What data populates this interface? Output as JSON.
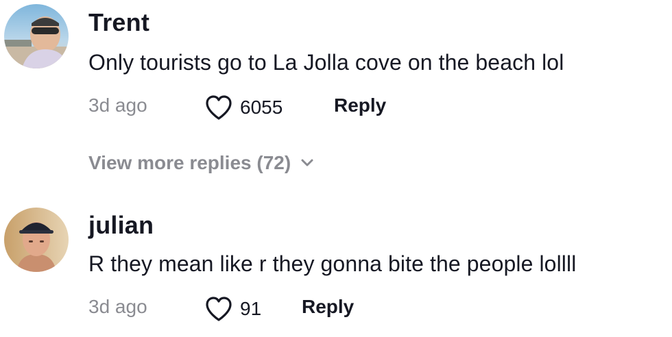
{
  "comments": [
    {
      "username": "Trent",
      "text": "Only tourists go to La Jolla cove on the beach lol",
      "time": "3d ago",
      "likes": "6055",
      "reply_label": "Reply"
    },
    {
      "username": "julian",
      "text": "R they mean like r they gonna bite the people lollll",
      "time": "3d ago",
      "likes": "91",
      "reply_label": "Reply"
    }
  ],
  "view_more": {
    "label": "View more replies (72)"
  },
  "icons": {
    "like": "heart-outline-icon",
    "expand": "chevron-down-icon"
  },
  "colors": {
    "text": "#161823",
    "secondary": "#8a8b91"
  }
}
